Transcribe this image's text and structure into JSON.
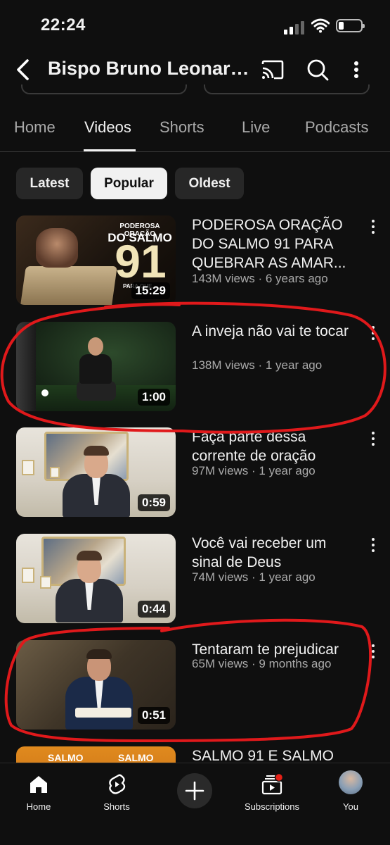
{
  "status_bar": {
    "time": "22:24"
  },
  "header": {
    "channel_title": "Bispo Bruno Leonardo",
    "icons": [
      "back-arrow-icon",
      "cast-icon",
      "search-icon",
      "more-vertical-icon"
    ]
  },
  "tabs": [
    "Home",
    "Videos",
    "Shorts",
    "Live",
    "Podcasts"
  ],
  "active_tab": "Videos",
  "chips": [
    "Latest",
    "Popular",
    "Oldest"
  ],
  "selected_chip": "Popular",
  "thumbnail_text": {
    "v1_top": "PODEROSA ORAÇÃO",
    "v1_do": "DO SALMO",
    "v1_num": "91",
    "v1_para": "PARA QUE...",
    "v6_left": "SALMO",
    "v6_right": "SALMO"
  },
  "videos": [
    {
      "title": "PODEROSA ORAÇÃO DO SALMO 91 PARA QUEBRAR AS AMAR...",
      "meta": "143M views · 6 years ago",
      "duration": "15:29"
    },
    {
      "title": "A inveja não vai te tocar",
      "meta": "138M views · 1 year ago",
      "duration": "1:00"
    },
    {
      "title": "Faça parte dessa corrente de oração",
      "meta": "97M views · 1 year ago",
      "duration": "0:59"
    },
    {
      "title": "Você vai receber um sinal de Deus",
      "meta": "74M views · 1 year ago",
      "duration": "0:44"
    },
    {
      "title": "Tentaram te prejudicar",
      "meta": "65M views · 9 months ago",
      "duration": "0:51"
    },
    {
      "title": "SALMO 91 E SALMO",
      "meta": "",
      "duration": ""
    }
  ],
  "bottom_nav": [
    {
      "label": "Home",
      "icon": "home-icon"
    },
    {
      "label": "Shorts",
      "icon": "shorts-icon"
    },
    {
      "label": "",
      "icon": "create-plus-icon"
    },
    {
      "label": "Subscriptions",
      "icon": "subscriptions-icon"
    },
    {
      "label": "You",
      "icon": "avatar"
    }
  ],
  "colors": {
    "background": "#0f0f0f",
    "chip": "#272727",
    "secondary_text": "#aaaaaa",
    "annotation": "#e0191b",
    "notification": "#e62117"
  }
}
